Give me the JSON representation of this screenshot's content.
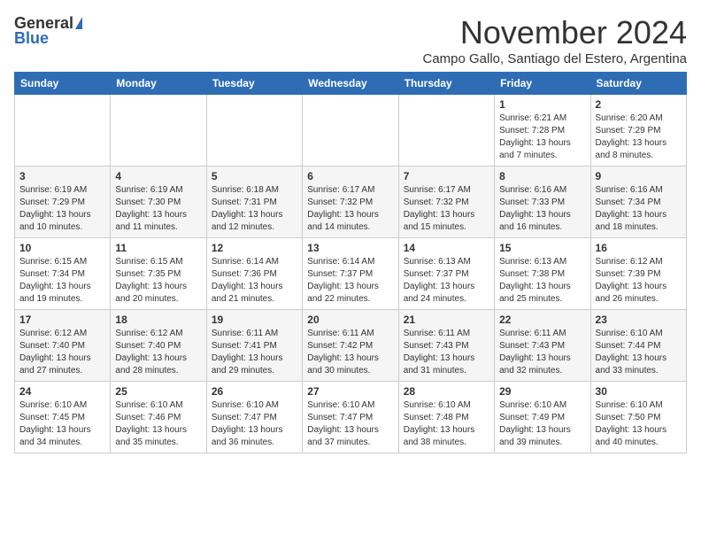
{
  "logo": {
    "general": "General",
    "blue": "Blue"
  },
  "header": {
    "month": "November 2024",
    "location": "Campo Gallo, Santiago del Estero, Argentina"
  },
  "weekdays": [
    "Sunday",
    "Monday",
    "Tuesday",
    "Wednesday",
    "Thursday",
    "Friday",
    "Saturday"
  ],
  "weeks": [
    [
      {
        "day": "",
        "info": ""
      },
      {
        "day": "",
        "info": ""
      },
      {
        "day": "",
        "info": ""
      },
      {
        "day": "",
        "info": ""
      },
      {
        "day": "",
        "info": ""
      },
      {
        "day": "1",
        "info": "Sunrise: 6:21 AM\nSunset: 7:28 PM\nDaylight: 13 hours\nand 7 minutes."
      },
      {
        "day": "2",
        "info": "Sunrise: 6:20 AM\nSunset: 7:29 PM\nDaylight: 13 hours\nand 8 minutes."
      }
    ],
    [
      {
        "day": "3",
        "info": "Sunrise: 6:19 AM\nSunset: 7:29 PM\nDaylight: 13 hours\nand 10 minutes."
      },
      {
        "day": "4",
        "info": "Sunrise: 6:19 AM\nSunset: 7:30 PM\nDaylight: 13 hours\nand 11 minutes."
      },
      {
        "day": "5",
        "info": "Sunrise: 6:18 AM\nSunset: 7:31 PM\nDaylight: 13 hours\nand 12 minutes."
      },
      {
        "day": "6",
        "info": "Sunrise: 6:17 AM\nSunset: 7:32 PM\nDaylight: 13 hours\nand 14 minutes."
      },
      {
        "day": "7",
        "info": "Sunrise: 6:17 AM\nSunset: 7:32 PM\nDaylight: 13 hours\nand 15 minutes."
      },
      {
        "day": "8",
        "info": "Sunrise: 6:16 AM\nSunset: 7:33 PM\nDaylight: 13 hours\nand 16 minutes."
      },
      {
        "day": "9",
        "info": "Sunrise: 6:16 AM\nSunset: 7:34 PM\nDaylight: 13 hours\nand 18 minutes."
      }
    ],
    [
      {
        "day": "10",
        "info": "Sunrise: 6:15 AM\nSunset: 7:34 PM\nDaylight: 13 hours\nand 19 minutes."
      },
      {
        "day": "11",
        "info": "Sunrise: 6:15 AM\nSunset: 7:35 PM\nDaylight: 13 hours\nand 20 minutes."
      },
      {
        "day": "12",
        "info": "Sunrise: 6:14 AM\nSunset: 7:36 PM\nDaylight: 13 hours\nand 21 minutes."
      },
      {
        "day": "13",
        "info": "Sunrise: 6:14 AM\nSunset: 7:37 PM\nDaylight: 13 hours\nand 22 minutes."
      },
      {
        "day": "14",
        "info": "Sunrise: 6:13 AM\nSunset: 7:37 PM\nDaylight: 13 hours\nand 24 minutes."
      },
      {
        "day": "15",
        "info": "Sunrise: 6:13 AM\nSunset: 7:38 PM\nDaylight: 13 hours\nand 25 minutes."
      },
      {
        "day": "16",
        "info": "Sunrise: 6:12 AM\nSunset: 7:39 PM\nDaylight: 13 hours\nand 26 minutes."
      }
    ],
    [
      {
        "day": "17",
        "info": "Sunrise: 6:12 AM\nSunset: 7:40 PM\nDaylight: 13 hours\nand 27 minutes."
      },
      {
        "day": "18",
        "info": "Sunrise: 6:12 AM\nSunset: 7:40 PM\nDaylight: 13 hours\nand 28 minutes."
      },
      {
        "day": "19",
        "info": "Sunrise: 6:11 AM\nSunset: 7:41 PM\nDaylight: 13 hours\nand 29 minutes."
      },
      {
        "day": "20",
        "info": "Sunrise: 6:11 AM\nSunset: 7:42 PM\nDaylight: 13 hours\nand 30 minutes."
      },
      {
        "day": "21",
        "info": "Sunrise: 6:11 AM\nSunset: 7:43 PM\nDaylight: 13 hours\nand 31 minutes."
      },
      {
        "day": "22",
        "info": "Sunrise: 6:11 AM\nSunset: 7:43 PM\nDaylight: 13 hours\nand 32 minutes."
      },
      {
        "day": "23",
        "info": "Sunrise: 6:10 AM\nSunset: 7:44 PM\nDaylight: 13 hours\nand 33 minutes."
      }
    ],
    [
      {
        "day": "24",
        "info": "Sunrise: 6:10 AM\nSunset: 7:45 PM\nDaylight: 13 hours\nand 34 minutes."
      },
      {
        "day": "25",
        "info": "Sunrise: 6:10 AM\nSunset: 7:46 PM\nDaylight: 13 hours\nand 35 minutes."
      },
      {
        "day": "26",
        "info": "Sunrise: 6:10 AM\nSunset: 7:47 PM\nDaylight: 13 hours\nand 36 minutes."
      },
      {
        "day": "27",
        "info": "Sunrise: 6:10 AM\nSunset: 7:47 PM\nDaylight: 13 hours\nand 37 minutes."
      },
      {
        "day": "28",
        "info": "Sunrise: 6:10 AM\nSunset: 7:48 PM\nDaylight: 13 hours\nand 38 minutes."
      },
      {
        "day": "29",
        "info": "Sunrise: 6:10 AM\nSunset: 7:49 PM\nDaylight: 13 hours\nand 39 minutes."
      },
      {
        "day": "30",
        "info": "Sunrise: 6:10 AM\nSunset: 7:50 PM\nDaylight: 13 hours\nand 40 minutes."
      }
    ]
  ]
}
